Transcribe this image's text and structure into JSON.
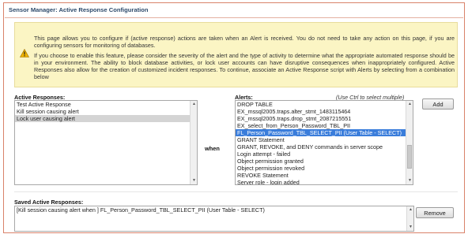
{
  "page": {
    "title": "Sensor Manager: Active Response Configuration"
  },
  "warning": {
    "icon": "warning-icon",
    "paragraph1": "This page allows you to configure if (active response) actions are taken when an Alert is received. You do not need to take any action on this page, if you are configuring sensors for monitoring of databases.",
    "paragraph2": "If you choose to enable this feature, please consider the severity of the alert and the type of activity to determine what the appropriate automated response should be in your environment. The ability to block database activities, or lock user accounts can have disruptive consequences when inappropriately configured. Active Responses also allow for the creation of customized incident responses. To continue, associate an Active Response script with Alerts by selecting from a combination below"
  },
  "active_responses": {
    "label": "Active Responses:",
    "items": [
      {
        "label": "Test Active Response",
        "selected": false
      },
      {
        "label": "Kill session causing alert",
        "selected": false
      },
      {
        "label": "Lock user causing alert",
        "selected": true
      }
    ]
  },
  "when_label": "when",
  "alerts": {
    "label": "Alerts:",
    "hint": "(Use Ctrl to select multiple)",
    "items": [
      {
        "label": "DROP TABLE",
        "selected": false
      },
      {
        "label": "EX_mssql2005.traps.alter_stmt_1483115464",
        "selected": false
      },
      {
        "label": "EX_mssql2005.traps.drop_stmt_2087215551",
        "selected": false
      },
      {
        "label": "EX_select_from_Person_Password_TBL_PII",
        "selected": false
      },
      {
        "label": "FL_Person_Password_TBL_SELECT_PII (User Table - SELECT)",
        "selected": true
      },
      {
        "label": "GRANT Statement",
        "selected": false
      },
      {
        "label": "GRANT, REVOKE, and DENY commands in server scope",
        "selected": false
      },
      {
        "label": "Login attempt - failed",
        "selected": false
      },
      {
        "label": "Object permission granted",
        "selected": false
      },
      {
        "label": "Object permission revoked",
        "selected": false
      },
      {
        "label": "REVOKE Statement",
        "selected": false
      },
      {
        "label": "Server role - login added",
        "selected": false
      }
    ],
    "add_button": "Add"
  },
  "saved": {
    "label": "Saved Active Responses:",
    "items": [
      {
        "label": "[Kill session causing alert when ] FL_Person_Password_TBL_SELECT_PII (User Table - SELECT)",
        "selected": false
      }
    ],
    "remove_button": "Remove"
  },
  "colors": {
    "title": "#2d4a6b",
    "frame_border": "#d9826a",
    "warning_bg": "#fbf5c4",
    "selection_blue": "#3a7ddb",
    "selection_gray": "#d4d4d4"
  }
}
